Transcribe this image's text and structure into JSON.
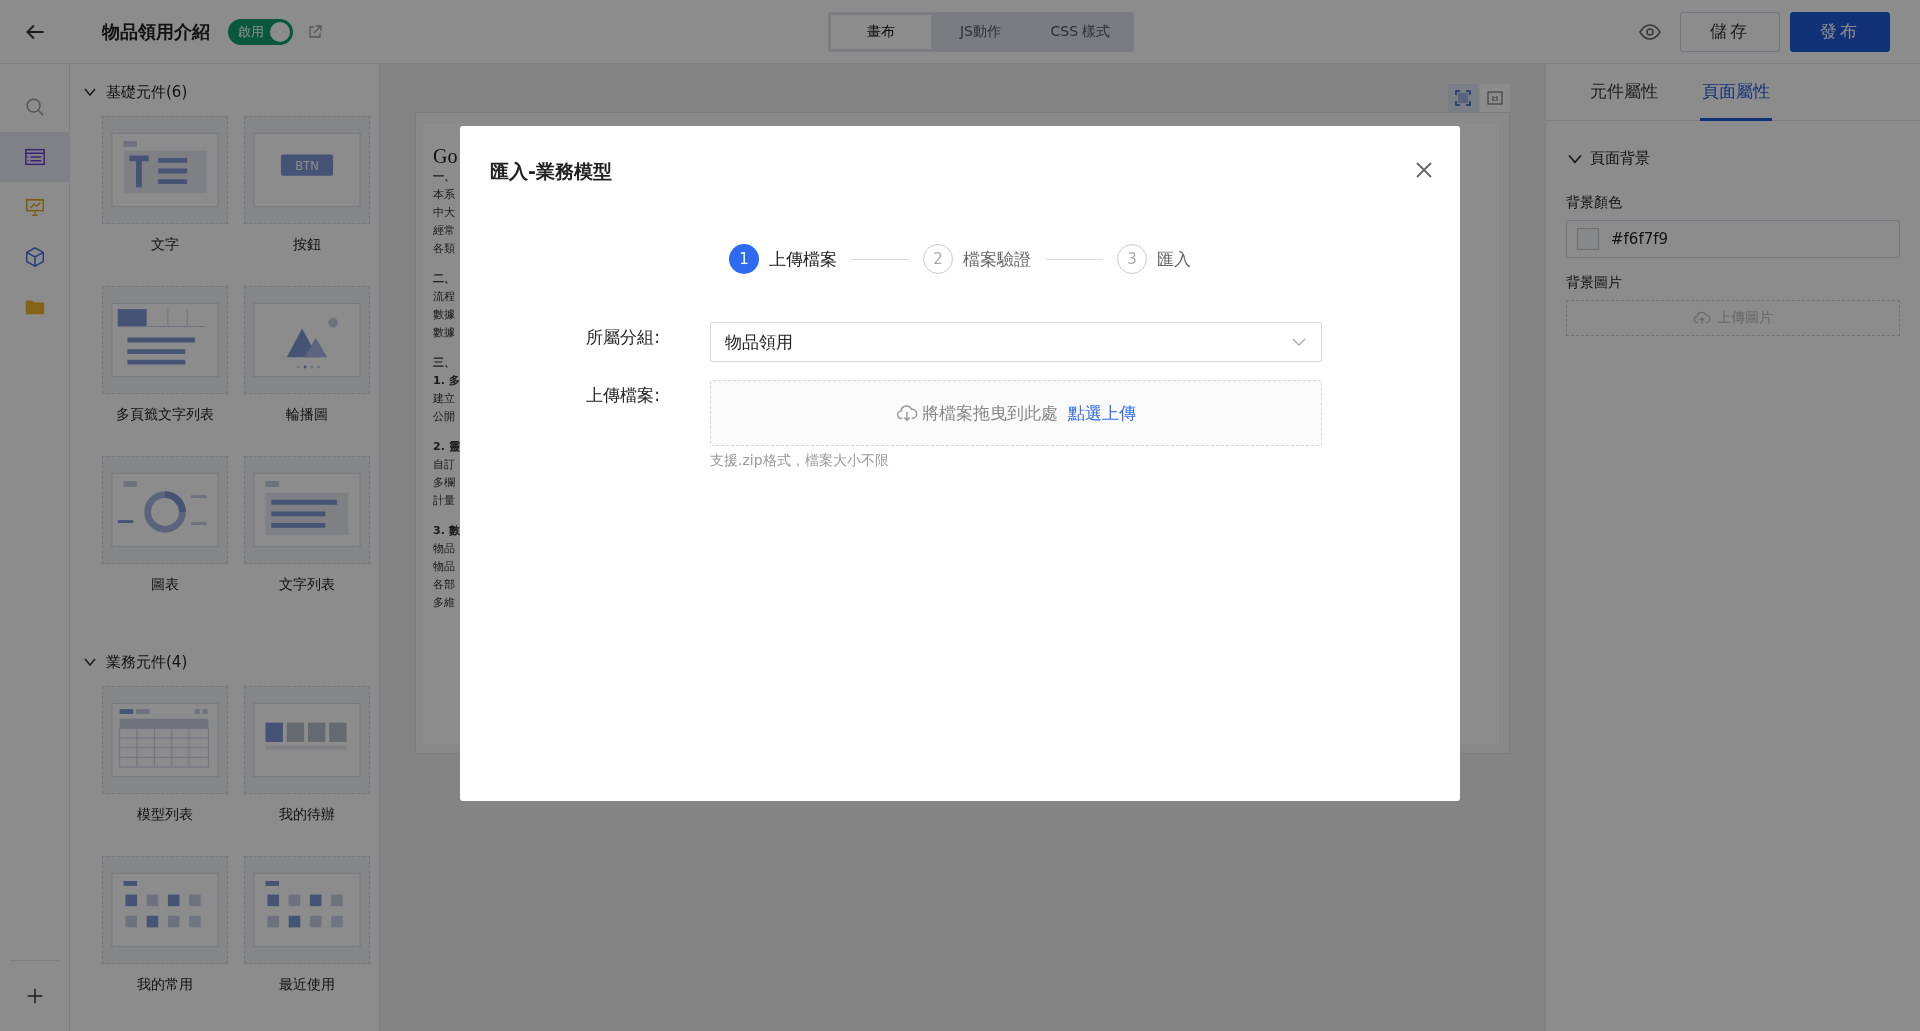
{
  "header": {
    "title": "物品領用介紹",
    "toggle": {
      "label": "啟用",
      "on": true
    },
    "view_tabs": [
      {
        "label": "畫布",
        "selected": true
      },
      {
        "label": "JS動作",
        "selected": false
      },
      {
        "label": "CSS 樣式",
        "selected": false
      }
    ],
    "buttons": [
      {
        "label": "儲存",
        "kind": "default"
      },
      {
        "label": "發布",
        "kind": "primary"
      }
    ]
  },
  "rail": {
    "items": [
      {
        "selected": false
      },
      {
        "selected": true
      },
      {
        "selected": false
      },
      {
        "selected": false
      },
      {
        "selected": false
      }
    ]
  },
  "palette": {
    "button_preview_text": "BTN",
    "sections": [
      {
        "title": "基礎元件(6)",
        "expanded": true,
        "items": [
          {
            "label": "文字",
            "kind": "text"
          },
          {
            "label": "按鈕",
            "kind": "button"
          },
          {
            "label": "多頁籤文字列表",
            "kind": "tabs"
          },
          {
            "label": "輪播圖",
            "kind": "carousel"
          },
          {
            "label": "圖表",
            "kind": "chart"
          },
          {
            "label": "文字列表",
            "kind": "list"
          }
        ]
      },
      {
        "title": "業務元件(4)",
        "expanded": true,
        "items": [
          {
            "label": "模型列表",
            "kind": "table"
          },
          {
            "label": "我的待辦",
            "kind": "todo"
          },
          {
            "label": "我的常用",
            "kind": "grid"
          },
          {
            "label": "最近使用",
            "kind": "grid"
          }
        ]
      }
    ]
  },
  "canvas": {
    "zoom_modes": [
      {
        "selected": true
      },
      {
        "selected": false
      }
    ],
    "document": {
      "heading": "Go",
      "paragraphs": [
        {
          "lines": [
            {
              "text": "一、",
              "kind": "heading"
            },
            {
              "text": "本系",
              "kind": "text"
            },
            {
              "text": "中大",
              "kind": "text"
            },
            {
              "text": "經常",
              "kind": "text"
            },
            {
              "text": "各類",
              "kind": "text"
            }
          ]
        },
        {
          "lines": [
            {
              "text": "二、",
              "kind": "heading"
            },
            {
              "text": "流程",
              "kind": "text"
            },
            {
              "text": "數據",
              "kind": "text"
            },
            {
              "text": "數據",
              "kind": "text"
            }
          ]
        },
        {
          "lines": [
            {
              "text": "三、",
              "kind": "heading"
            },
            {
              "text": "1. 多",
              "kind": "heading"
            },
            {
              "text": "建立",
              "kind": "text"
            },
            {
              "text": "公開",
              "kind": "text"
            }
          ]
        },
        {
          "lines": [
            {
              "text": "2. 靈",
              "kind": "heading"
            },
            {
              "text": "自訂",
              "kind": "text"
            },
            {
              "text": "多欄",
              "kind": "text"
            },
            {
              "text": "計量",
              "kind": "text"
            }
          ]
        },
        {
          "lines": [
            {
              "text": "3. 數",
              "kind": "heading"
            },
            {
              "text": "物品",
              "kind": "text"
            },
            {
              "text": "物品",
              "kind": "text"
            },
            {
              "text": "各部",
              "kind": "text"
            },
            {
              "text": "多維",
              "kind": "text"
            }
          ]
        }
      ]
    }
  },
  "properties": {
    "tabs": [
      {
        "label": "元件屬性",
        "selected": false
      },
      {
        "label": "頁面屬性",
        "selected": true
      }
    ],
    "section": {
      "title": "頁面背景",
      "expanded": true
    },
    "fields": [
      {
        "kind": "color",
        "label": "背景顏色",
        "value": "#f6f7f9"
      },
      {
        "kind": "upload",
        "label": "背景圖片",
        "button": "上傳圖片"
      }
    ]
  },
  "modal": {
    "title": "匯入-業務模型",
    "steps": [
      {
        "number": "1",
        "label": "上傳檔案",
        "active": true
      },
      {
        "number": "2",
        "label": "檔案驗證",
        "active": false
      },
      {
        "number": "3",
        "label": "匯入",
        "active": false
      }
    ],
    "group": {
      "label": "所屬分組:",
      "value": "物品領用"
    },
    "upload": {
      "label": "上傳檔案:",
      "prompt": "將檔案拖曳到此處",
      "link": "點選上傳",
      "hint": "支援.zip格式，檔案大小不限"
    }
  }
}
